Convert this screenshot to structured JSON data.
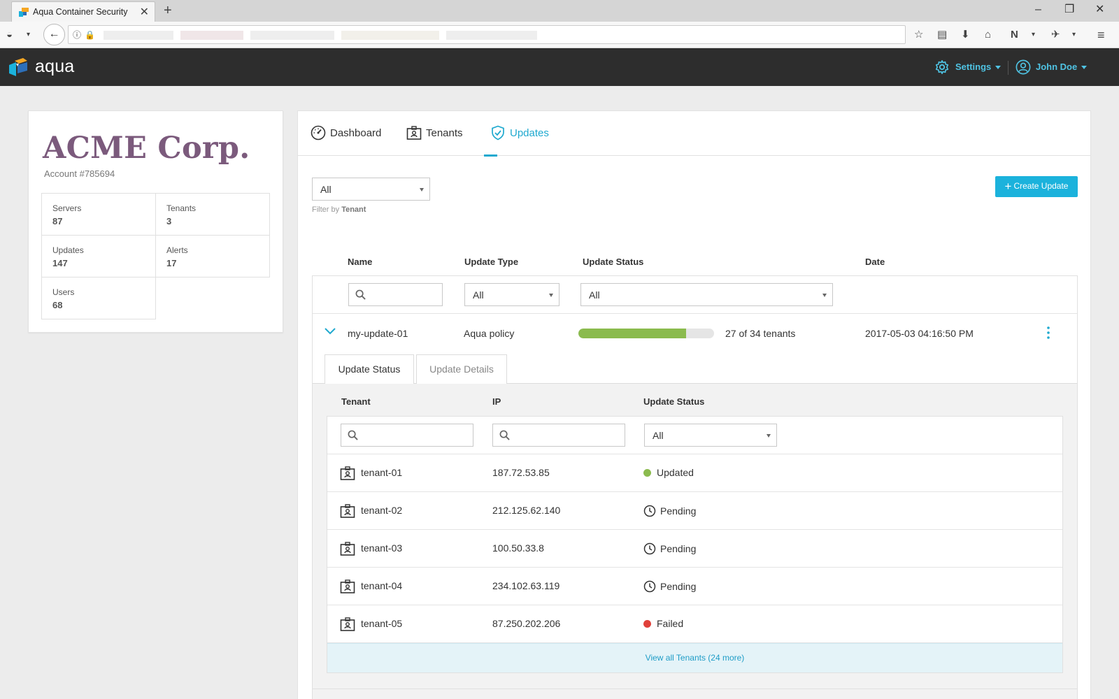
{
  "browser": {
    "tab_title": "Aqua Container Security",
    "tab_close": "✕",
    "new_tab": "+"
  },
  "header": {
    "logo": "aqua",
    "settings_label": "Settings",
    "user_label": "John Doe"
  },
  "account": {
    "company": "ACME Corp.",
    "account_number": "Account #785694",
    "stats": [
      {
        "label": "Servers",
        "value": "87"
      },
      {
        "label": "Tenants",
        "value": "3"
      },
      {
        "label": "Updates",
        "value": "147"
      },
      {
        "label": "Alerts",
        "value": "17"
      },
      {
        "label": "Users",
        "value": "68"
      }
    ]
  },
  "tabs": [
    {
      "label": "Dashboard",
      "icon": "dashboard-icon"
    },
    {
      "label": "Tenants",
      "icon": "tenant-icon"
    },
    {
      "label": "Updates",
      "icon": "shield-icon",
      "active": true
    }
  ],
  "filter": {
    "tenant_value": "All",
    "hint_prefix": "Filter by",
    "hint_bold": "Tenant"
  },
  "create_update_label": "Create Update",
  "updates_table": {
    "headers": {
      "name": "Name",
      "type": "Update Type",
      "status": "Update Status",
      "date": "Date"
    },
    "type_filter": "All",
    "status_filter": "All",
    "rows": [
      {
        "name": "my-update-01",
        "type": "Aqua policy",
        "progress_done": 27,
        "progress_total": 34,
        "progress_text": "27 of 34 tenants",
        "date": "2017-05-03 04:16:50 PM"
      }
    ]
  },
  "detail": {
    "subtabs": [
      "Update Status",
      "Update Details"
    ],
    "headers": {
      "tenant": "Tenant",
      "ip": "IP",
      "status": "Update Status"
    },
    "status_filter": "All",
    "rows": [
      {
        "tenant": "tenant-01",
        "ip": "187.72.53.85",
        "status": "Updated",
        "kind": "updated"
      },
      {
        "tenant": "tenant-02",
        "ip": "212.125.62.140",
        "status": "Pending",
        "kind": "pending"
      },
      {
        "tenant": "tenant-03",
        "ip": "100.50.33.8",
        "status": "Pending",
        "kind": "pending"
      },
      {
        "tenant": "tenant-04",
        "ip": "234.102.63.119",
        "status": "Pending",
        "kind": "pending"
      },
      {
        "tenant": "tenant-05",
        "ip": "87.250.202.206",
        "status": "Failed",
        "kind": "failed"
      }
    ],
    "view_all": "View all Tenants (24 more)"
  },
  "colors": {
    "accent": "#1fa9cf",
    "updated": "#8bbb4e",
    "failed": "#e0403a",
    "brand_purple": "#7b5a7c"
  }
}
